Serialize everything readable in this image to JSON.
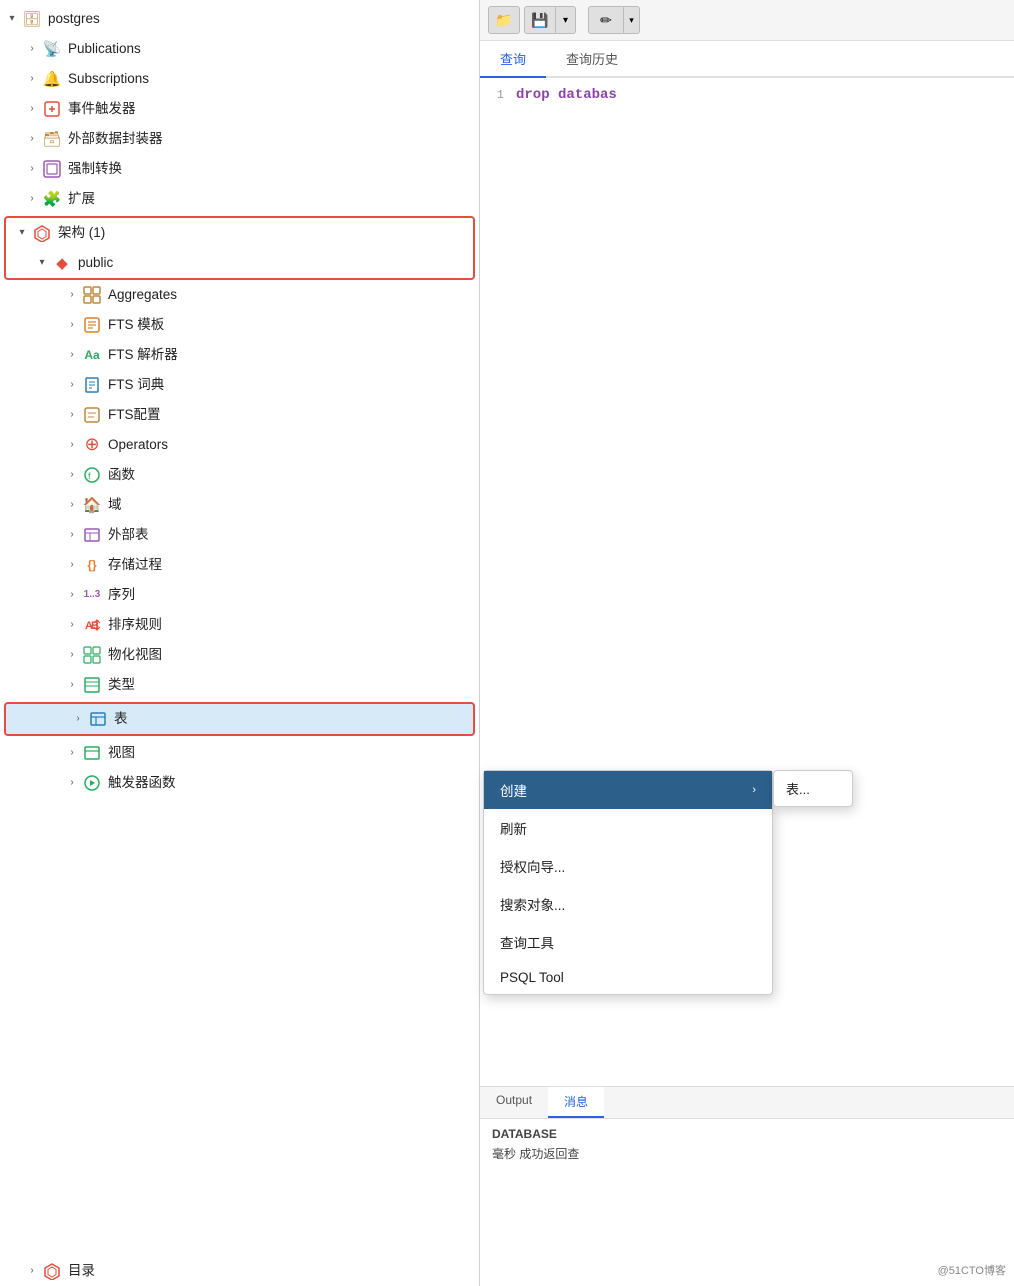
{
  "tree": {
    "root": {
      "label": "postgres",
      "icon": "🗄",
      "iconColor": "#c0883c"
    },
    "items": [
      {
        "id": "publications",
        "label": "Publications",
        "icon": "📡",
        "iconColor": "#e67e22",
        "indent": 1,
        "hasChevron": true,
        "collapsed": true
      },
      {
        "id": "subscriptions",
        "label": "Subscriptions",
        "icon": "🔔",
        "iconColor": "#e67e22",
        "indent": 1,
        "hasChevron": true,
        "collapsed": true
      },
      {
        "id": "event-triggers",
        "label": "事件触发器",
        "icon": "⚡",
        "iconColor": "#e74c3c",
        "indent": 1,
        "hasChevron": true,
        "collapsed": true
      },
      {
        "id": "foreign-wrappers",
        "label": "外部数据封装器",
        "icon": "🗃",
        "iconColor": "#c0883c",
        "indent": 1,
        "hasChevron": true,
        "collapsed": true
      },
      {
        "id": "cast",
        "label": "强制转换",
        "icon": "🔲",
        "iconColor": "#9b59b6",
        "indent": 1,
        "hasChevron": true,
        "collapsed": true
      },
      {
        "id": "extensions",
        "label": "扩展",
        "icon": "🧩",
        "iconColor": "#27ae60",
        "indent": 1,
        "hasChevron": true,
        "collapsed": true
      },
      {
        "id": "schema-group",
        "label": "架构 (1)",
        "icon": "❋",
        "iconColor": "#e74c3c",
        "indent": 1,
        "hasChevron": true,
        "collapsed": false,
        "redOutline": true
      },
      {
        "id": "public",
        "label": "public",
        "icon": "◆",
        "iconColor": "#e74c3c",
        "indent": 2,
        "hasChevron": true,
        "collapsed": false,
        "redOutlineChild": true
      },
      {
        "id": "aggregates",
        "label": "Aggregates",
        "icon": "▦",
        "iconColor": "#c0883c",
        "indent": 3,
        "hasChevron": true,
        "collapsed": true
      },
      {
        "id": "fts-template",
        "label": "FTS 模板",
        "icon": "◧",
        "iconColor": "#e67e22",
        "indent": 3,
        "hasChevron": true,
        "collapsed": true
      },
      {
        "id": "fts-parser",
        "label": "FTS 解析器",
        "icon": "Aa",
        "iconColor": "#27ae60",
        "indent": 3,
        "hasChevron": true,
        "collapsed": true,
        "isText": true
      },
      {
        "id": "fts-dict",
        "label": "FTS 词典",
        "icon": "📚",
        "iconColor": "#2980b9",
        "indent": 3,
        "hasChevron": true,
        "collapsed": true
      },
      {
        "id": "fts-config",
        "label": "FTS配置",
        "icon": "📋",
        "iconColor": "#c0883c",
        "indent": 3,
        "hasChevron": true,
        "collapsed": true
      },
      {
        "id": "operators",
        "label": "Operators",
        "icon": "⊕",
        "iconColor": "#e74c3c",
        "indent": 3,
        "hasChevron": true,
        "collapsed": true
      },
      {
        "id": "functions",
        "label": "函数",
        "icon": "⚙",
        "iconColor": "#27ae60",
        "indent": 3,
        "hasChevron": true,
        "collapsed": true
      },
      {
        "id": "domains",
        "label": "域",
        "icon": "🏠",
        "iconColor": "#e67e22",
        "indent": 3,
        "hasChevron": true,
        "collapsed": true
      },
      {
        "id": "foreign-tables",
        "label": "外部表",
        "icon": "▣",
        "iconColor": "#9b59b6",
        "indent": 3,
        "hasChevron": true,
        "collapsed": true
      },
      {
        "id": "procedures",
        "label": "存储过程",
        "icon": "{}",
        "iconColor": "#e67e22",
        "indent": 3,
        "hasChevron": true,
        "collapsed": true,
        "isText": true
      },
      {
        "id": "sequences",
        "label": "序列",
        "icon": "1..3",
        "iconColor": "#9b59b6",
        "indent": 3,
        "hasChevron": true,
        "collapsed": true,
        "isText": true
      },
      {
        "id": "collations",
        "label": "排序规则",
        "icon": "↕",
        "iconColor": "#e74c3c",
        "indent": 3,
        "hasChevron": true,
        "collapsed": true
      },
      {
        "id": "mat-views",
        "label": "物化视图",
        "icon": "▦",
        "iconColor": "#27ae60",
        "indent": 3,
        "hasChevron": true,
        "collapsed": true
      },
      {
        "id": "types",
        "label": "类型",
        "icon": "▤",
        "iconColor": "#27ae60",
        "indent": 3,
        "hasChevron": true,
        "collapsed": true
      },
      {
        "id": "tables",
        "label": "表",
        "icon": "▣",
        "iconColor": "#2980b9",
        "indent": 3,
        "hasChevron": true,
        "collapsed": true,
        "selected": true,
        "redOutline": true
      },
      {
        "id": "views",
        "label": "视图",
        "icon": "▧",
        "iconColor": "#27ae60",
        "indent": 3,
        "hasChevron": true,
        "collapsed": true
      },
      {
        "id": "trigger-functions",
        "label": "触发器函数",
        "icon": "⚙",
        "iconColor": "#27ae60",
        "indent": 3,
        "hasChevron": true,
        "collapsed": true
      }
    ],
    "bottom_items": [
      {
        "id": "catalog",
        "label": "目录",
        "icon": "❋",
        "iconColor": "#e74c3c",
        "indent": 1,
        "hasChevron": true,
        "collapsed": true
      }
    ]
  },
  "context_menu": {
    "items": [
      {
        "id": "create",
        "label": "创建",
        "active": true,
        "hasSubmenu": true
      },
      {
        "id": "refresh",
        "label": "刷新",
        "active": false
      },
      {
        "id": "grant-wizard",
        "label": "授权向导...",
        "active": false
      },
      {
        "id": "search-objects",
        "label": "搜索对象...",
        "active": false
      },
      {
        "id": "query-tool",
        "label": "查询工具",
        "active": false
      },
      {
        "id": "psql-tool",
        "label": "PSQL Tool",
        "active": false
      }
    ],
    "submenu_items": [
      {
        "id": "table",
        "label": "表..."
      }
    ]
  },
  "query_editor": {
    "tabs": [
      {
        "id": "query",
        "label": "查询",
        "active": true
      },
      {
        "id": "history",
        "label": "查询历史",
        "active": false
      }
    ],
    "code": "drop databas",
    "line_number": "1"
  },
  "output": {
    "tabs": [
      {
        "id": "output-tab",
        "label": "Output",
        "active": false
      },
      {
        "id": "messages-tab",
        "label": "消息",
        "active": true
      }
    ],
    "message": "DATABASE",
    "status": "毫秒  成功返回查"
  },
  "toolbar": {
    "folder_icon": "📁",
    "save_icon": "💾",
    "dropdown_icon": "▾",
    "edit_icon": "✏"
  },
  "watermark": "@51CTO博客"
}
